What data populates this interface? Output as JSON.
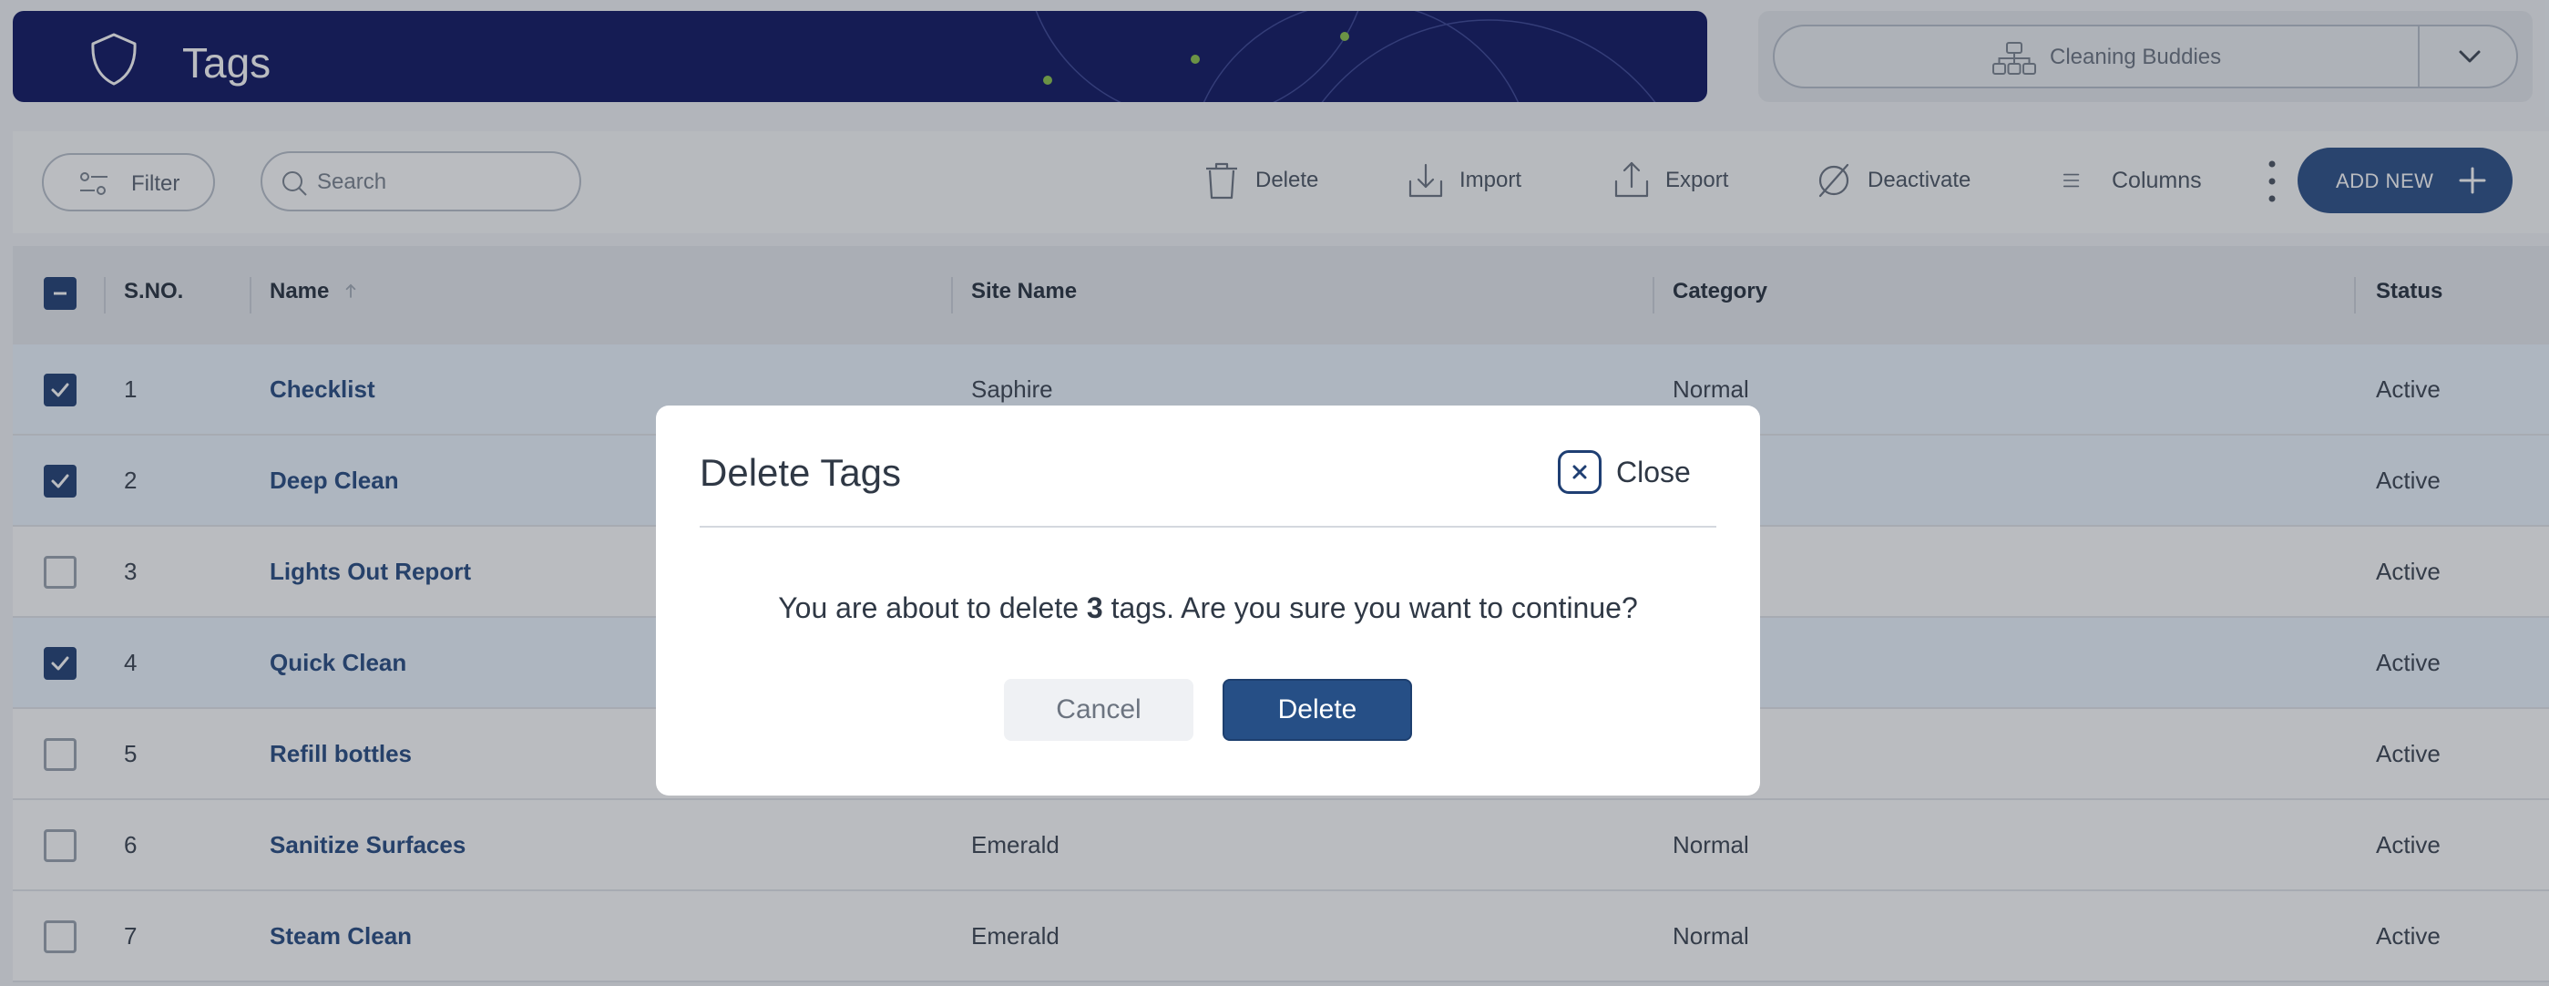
{
  "header": {
    "title": "Tags",
    "icon": "shield-icon",
    "banner_color": "#0c1461",
    "accent_dot_color": "#8bc34a"
  },
  "org_selector": {
    "value": "Cleaning Buddies",
    "icon": "org-chart-icon"
  },
  "toolbar": {
    "filter_label": "Filter",
    "search_placeholder": "Search",
    "delete_label": "Delete",
    "import_label": "Import",
    "export_label": "Export",
    "deactivate_label": "Deactivate",
    "columns_label": "Columns",
    "add_new_label": "ADD NEW",
    "primary_color": "#2a4e86"
  },
  "table": {
    "columns": [
      "S.NO.",
      "Name",
      "Site Name",
      "Category",
      "Status"
    ],
    "sort_column": "Name",
    "sort_direction": "ascending",
    "rows": [
      {
        "sno": "1",
        "name": "Checklist",
        "site": "Saphire",
        "category": "Normal",
        "status": "Active",
        "selected": true
      },
      {
        "sno": "2",
        "name": "Deep Clean",
        "site": "",
        "category": "",
        "status": "Active",
        "selected": true
      },
      {
        "sno": "3",
        "name": "Lights Out Report",
        "site": "",
        "category": "",
        "status": "Active",
        "selected": false
      },
      {
        "sno": "4",
        "name": "Quick Clean",
        "site": "",
        "category": "",
        "status": "Active",
        "selected": true
      },
      {
        "sno": "5",
        "name": "Refill bottles",
        "site": "",
        "category": "",
        "status": "Active",
        "selected": false
      },
      {
        "sno": "6",
        "name": "Sanitize Surfaces",
        "site": "Emerald",
        "category": "Normal",
        "status": "Active",
        "selected": false
      },
      {
        "sno": "7",
        "name": "Steam Clean",
        "site": "Emerald",
        "category": "Normal",
        "status": "Active",
        "selected": false
      }
    ]
  },
  "modal": {
    "title": "Delete Tags",
    "close_label": "Close",
    "message_prefix": "You are about to delete ",
    "message_count": "3",
    "message_suffix": " tags. Are you sure you want to continue?",
    "cancel_label": "Cancel",
    "delete_label": "Delete"
  }
}
